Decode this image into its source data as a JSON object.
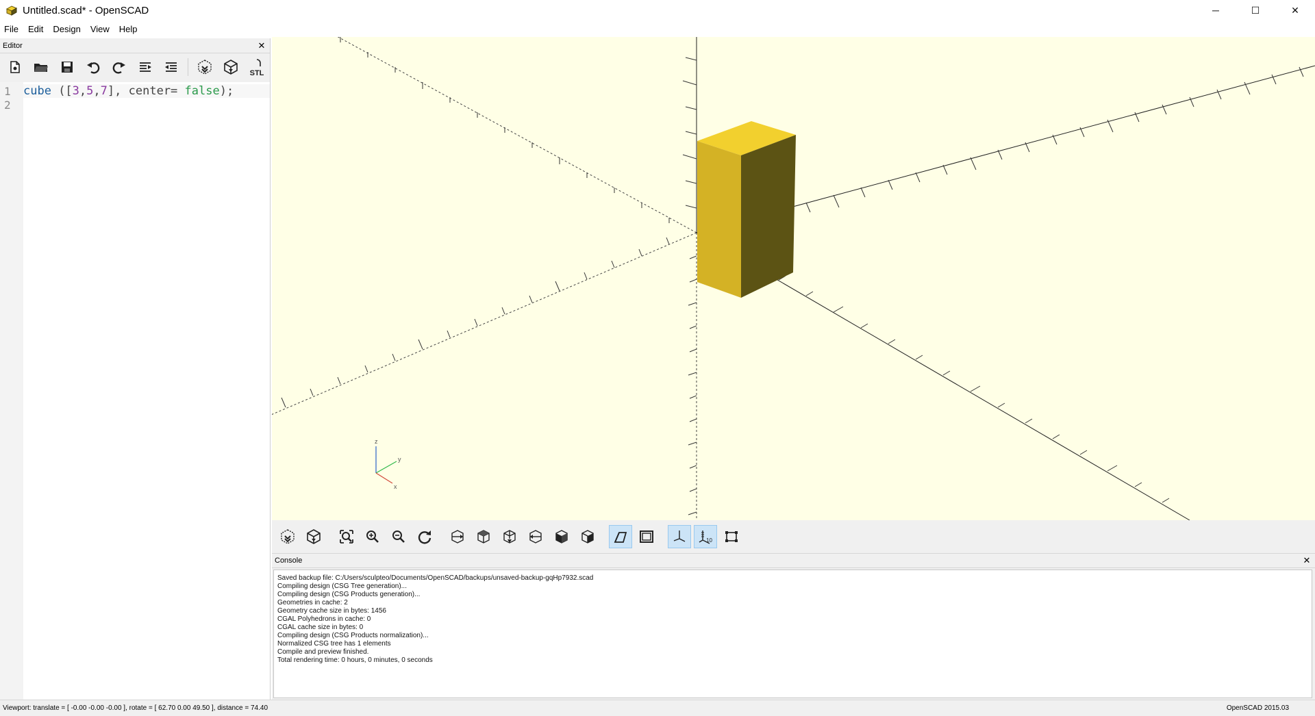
{
  "window": {
    "title": "Untitled.scad* - OpenSCAD",
    "minimize": "─",
    "maximize": "☐",
    "close": "✕"
  },
  "menu": [
    "File",
    "Edit",
    "Design",
    "View",
    "Help"
  ],
  "editor": {
    "header": "Editor",
    "close": "✕",
    "toolbar": [
      "new-file-icon",
      "open-file-icon",
      "save-icon",
      "undo-icon",
      "redo-icon",
      "unindent-icon",
      "indent-icon",
      "preview-icon",
      "render-icon",
      "export-stl-icon"
    ],
    "stl_label": "STL",
    "line_numbers": [
      "1",
      "2"
    ],
    "code": {
      "kw": "cube",
      "open": " ([",
      "n1": "3",
      "c1": ",",
      "n2": "5",
      "c2": ",",
      "n3": "7",
      "close": "], ",
      "arg": "center= ",
      "bool": "false",
      "end": ");"
    }
  },
  "viewport": {
    "background": "#ffffe6",
    "cube_top": "#f2d02e",
    "cube_left": "#d4b225",
    "cube_right": "#5c5314",
    "axis_gizmo": {
      "x": "x",
      "y": "y",
      "z": "z"
    }
  },
  "view_toolbar": [
    "preview-icon",
    "render-icon",
    "view-all-icon",
    "zoom-in-icon",
    "zoom-out-icon",
    "reset-view-icon",
    "view-right-icon",
    "view-top-icon",
    "view-bottom-icon",
    "view-left-icon",
    "view-front-icon",
    "view-back-icon",
    "perspective-icon",
    "orthogonal-icon",
    "show-axes-icon",
    "show-scale-markers-icon",
    "show-edges-icon"
  ],
  "console": {
    "header": "Console",
    "close": "✕",
    "lines": [
      "Saved backup file: C:/Users/sculpteo/Documents/OpenSCAD/backups/unsaved-backup-gqHp7932.scad",
      "Compiling design (CSG Tree generation)...",
      "Compiling design (CSG Products generation)...",
      "Geometries in cache: 2",
      "Geometry cache size in bytes: 1456",
      "CGAL Polyhedrons in cache: 0",
      "CGAL cache size in bytes: 0",
      "Compiling design (CSG Products normalization)...",
      "Normalized CSG tree has 1 elements",
      "Compile and preview finished.",
      "Total rendering time: 0 hours, 0 minutes, 0 seconds"
    ]
  },
  "status": {
    "viewport": "Viewport: translate = [ -0.00 -0.00 -0.00 ], rotate = [ 62.70 0.00 49.50 ], distance = 74.40",
    "version": "OpenSCAD 2015.03"
  }
}
